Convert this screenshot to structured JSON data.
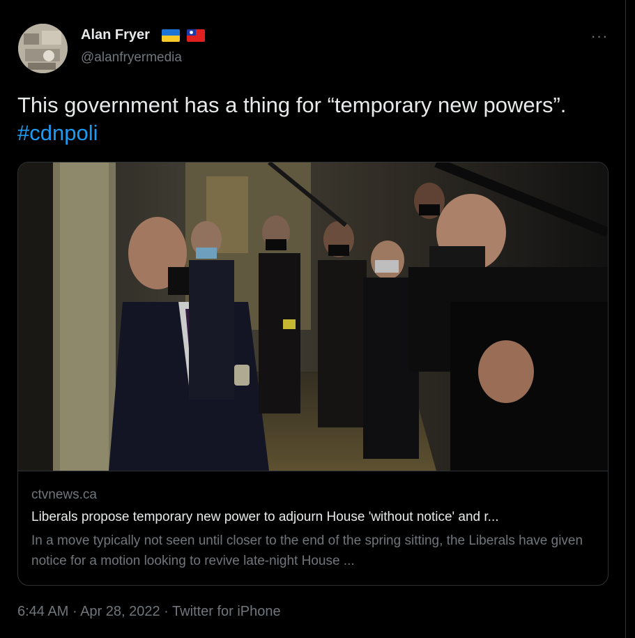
{
  "author": {
    "display_name": "Alan Fryer",
    "handle": "@alanfryermedia",
    "flags": [
      "ukraine-flag",
      "taiwan-flag"
    ]
  },
  "more_label": "···",
  "tweet": {
    "text_plain": "This government has a thing for “temporary new powers”. ",
    "hashtag": "#cdnpoli"
  },
  "card": {
    "domain": "ctvnews.ca",
    "title": "Liberals propose temporary new power to adjourn House 'without notice' and r...",
    "description": "In a move typically not seen until closer to the end of the spring sitting, the Liberals have given notice for a motion looking to revive late-night House ..."
  },
  "meta": {
    "time": "6:44 AM",
    "date": "Apr 28, 2022",
    "source": "Twitter for iPhone",
    "separator": " · "
  },
  "colors": {
    "background": "#000000",
    "text": "#e7e9ea",
    "secondary": "#71767b",
    "link": "#1d9bf0",
    "border": "#2f3336"
  }
}
